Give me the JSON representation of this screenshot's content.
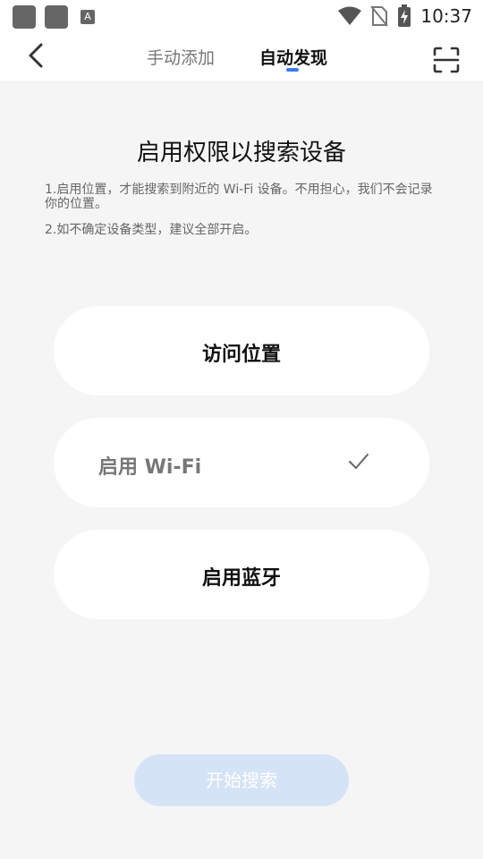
{
  "status_bar": {
    "time": "10:37",
    "notification_letter": "A",
    "icons": [
      "app-icon",
      "app-icon",
      "text-app-icon",
      "wifi-icon",
      "no-sim-icon",
      "battery-charging-icon"
    ]
  },
  "header": {
    "tabs": [
      {
        "label": "手动添加",
        "active": false
      },
      {
        "label": "自动发现",
        "active": true
      }
    ],
    "back_icon": "back-arrow-icon",
    "scan_icon": "scan-icon",
    "accent_color": "#3a7bf0"
  },
  "main": {
    "title": "启用权限以搜索设备",
    "description_1": "1.启用位置，才能搜索到附近的 Wi-Fi 设备。不用担心，我们不会记录你的位置。",
    "description_2": "2.如不确定设备类型，建议全部开启。",
    "permissions": [
      {
        "label": "访问位置",
        "enabled": false
      },
      {
        "label": "启用 Wi-Fi",
        "enabled": true
      },
      {
        "label": "启用蓝牙",
        "enabled": false
      }
    ],
    "start_button": "开始搜索"
  }
}
